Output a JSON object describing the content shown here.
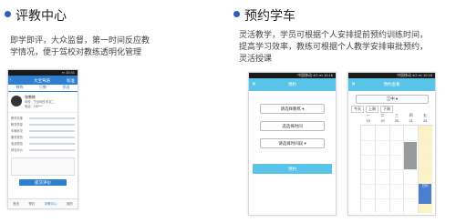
{
  "left": {
    "title": "评教中心",
    "desc_line1": "即学即评，大众监督，第一时间反应教",
    "desc_line2": "学情况，便于驾校对教练透明化管理",
    "phone": {
      "status": "▪▪ 10:41",
      "header_title": "大宝驾培",
      "header_right": "标准",
      "tabs": [
        "教练",
        "已教",
        "投诉"
      ],
      "profile_name": "张教练",
      "profile_line1": "驾校：宁远驾校  科目二",
      "profile_line2": "电话：138****",
      "rating_rows": [
        "教学态度",
        "教学质量",
        "车辆状况",
        "服务规范",
        "收费规范",
        "综合评价"
      ],
      "submit": "提交评价",
      "bottom_nav": [
        "首页",
        "预约",
        "评教中心",
        "我的"
      ]
    }
  },
  "right": {
    "title": "预约学车",
    "desc_line1": "灵活教学，学员可根据个人安排提前预约训练时间，",
    "desc_line2": "提高学习效率，教练可根据个人教学安排审批预约，",
    "desc_line3": "灵活授课",
    "phone1": {
      "status": "中国移动 4G  ▪▪▪ 10:16",
      "close": "✕",
      "header_title": "预约",
      "select1": "请选择教练 ▾",
      "select2": "选选择时间",
      "select3": "请选择时间段 ▾",
      "confirm": "预约"
    },
    "phone2": {
      "status": "中国移动 4G  ▪▪▪ 10:16",
      "close": "✕",
      "header_title": "预约查看",
      "select": "江中 ▾",
      "week_tabs": [
        "今天",
        "上周",
        "下周"
      ],
      "days": [
        "一",
        "二",
        "三",
        "四",
        "五"
      ],
      "dates": [
        "19",
        "19",
        "20",
        "21",
        "24"
      ],
      "event_label": "已约"
    }
  }
}
